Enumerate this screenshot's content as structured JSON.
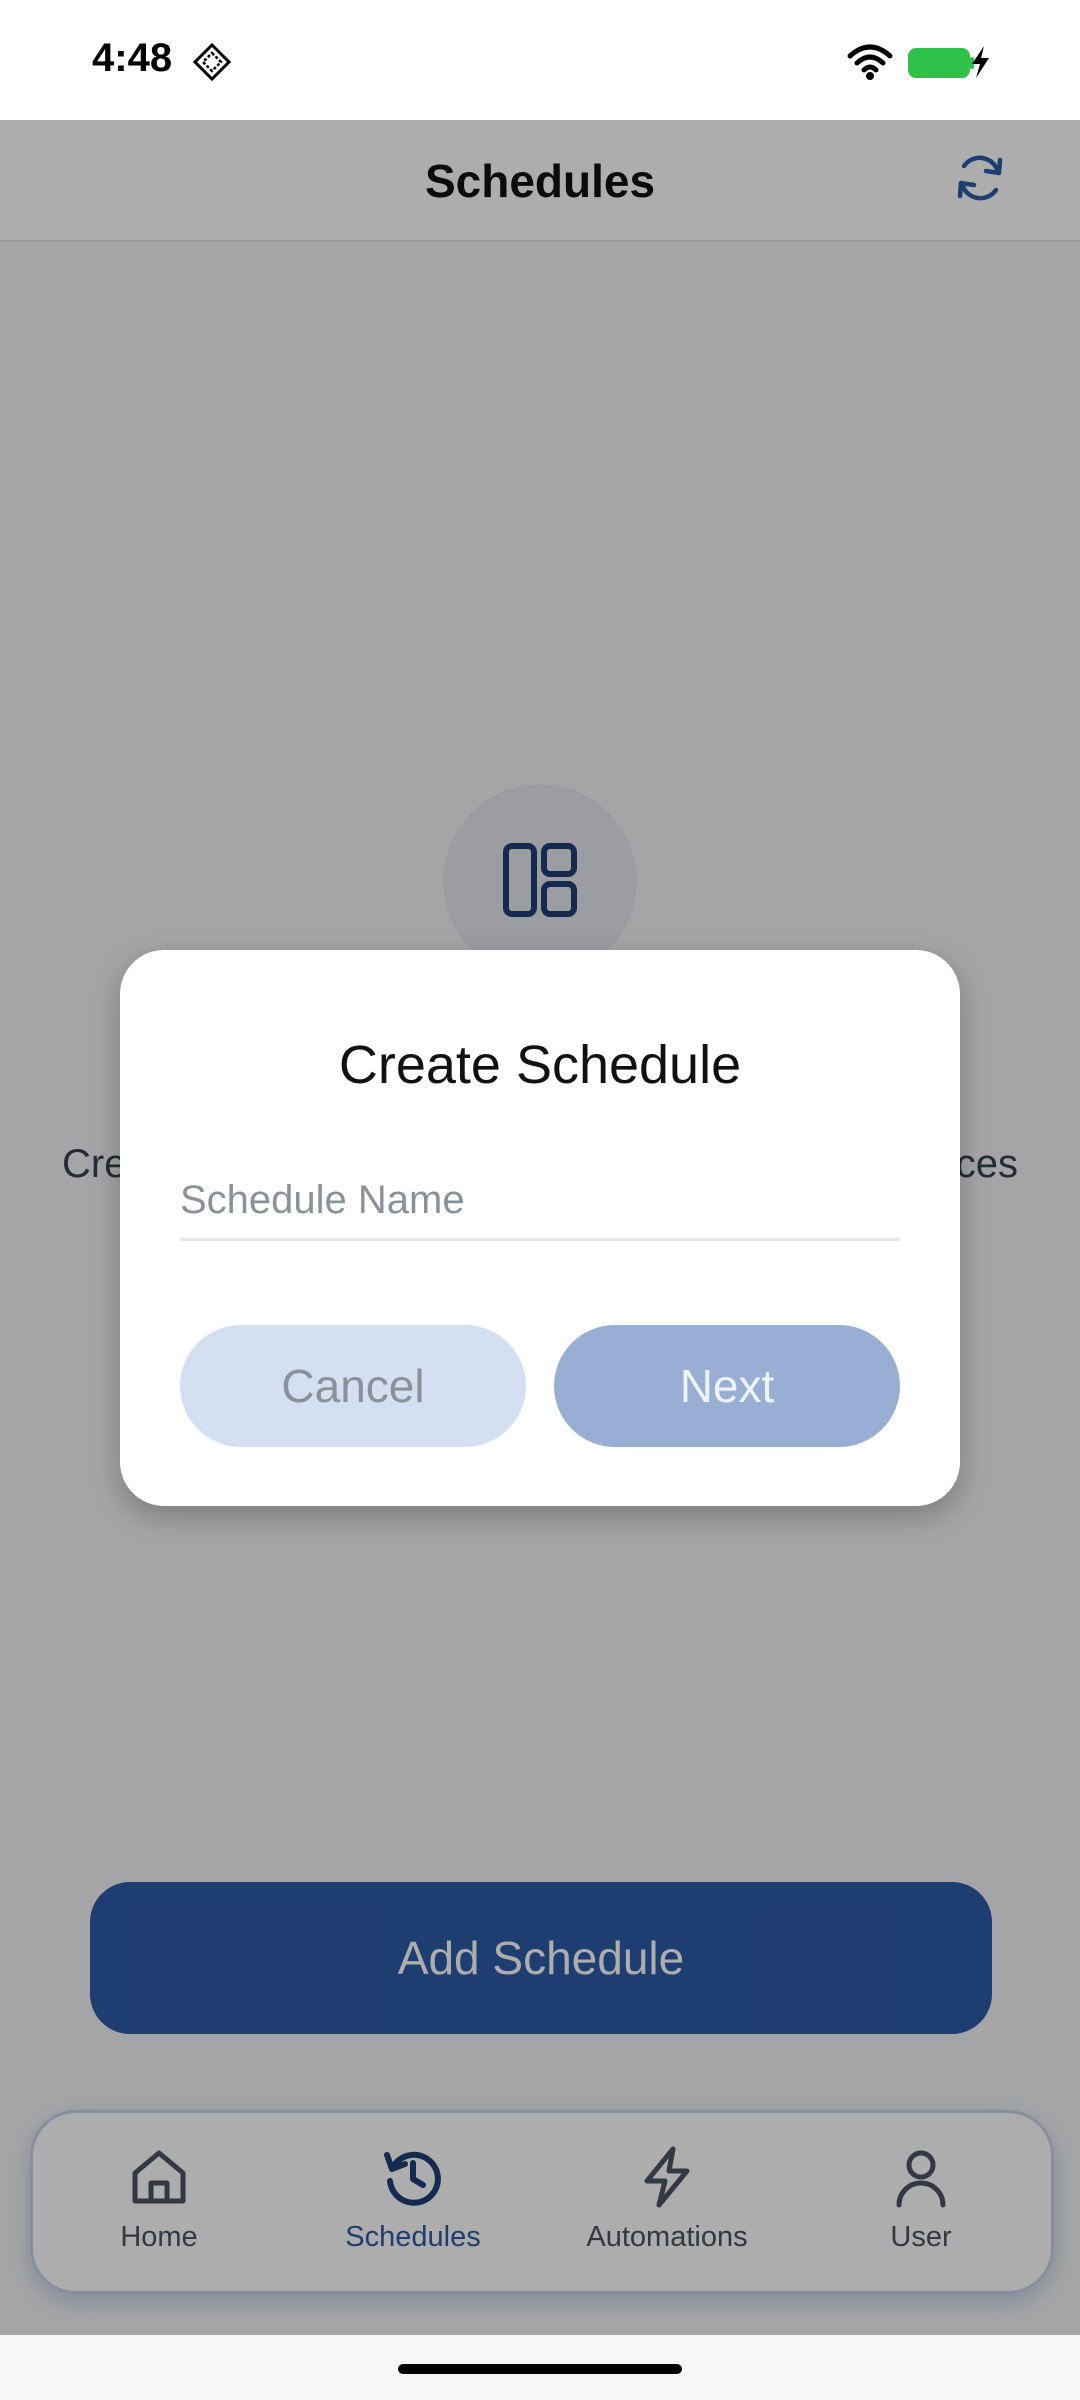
{
  "status_bar": {
    "time": "4:48"
  },
  "header": {
    "title": "Schedules"
  },
  "empty_state": {
    "text_left": "Cre",
    "text_right": "ces"
  },
  "add_button": {
    "label": "Add Schedule"
  },
  "nav": {
    "items": [
      {
        "label": "Home",
        "icon": "home-icon"
      },
      {
        "label": "Schedules",
        "icon": "history-icon",
        "active": true
      },
      {
        "label": "Automations",
        "icon": "lightning-icon"
      },
      {
        "label": "User",
        "icon": "user-icon"
      }
    ]
  },
  "dialog": {
    "title": "Create Schedule",
    "input_placeholder": "Schedule Name",
    "input_value": "",
    "cancel_label": "Cancel",
    "next_label": "Next"
  },
  "colors": {
    "primary": "#2d5aa6",
    "primary_disabled": "#98aed3",
    "secondary_disabled": "#d4e0f2"
  }
}
